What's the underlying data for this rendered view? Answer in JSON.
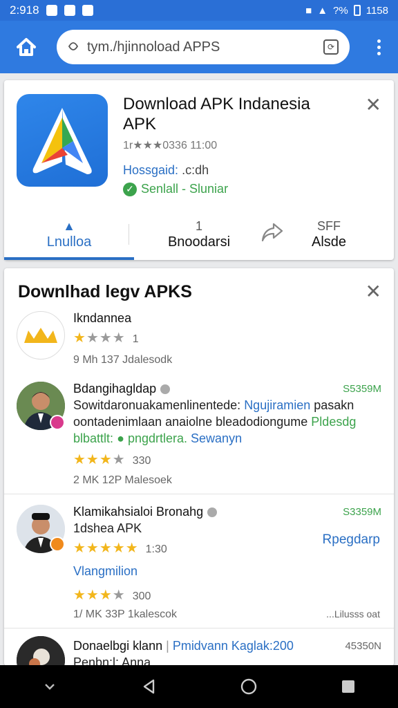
{
  "status": {
    "time": "2:918",
    "battery": "?%",
    "clock": "1158"
  },
  "browser": {
    "url": "tym./hjinnoload APPS",
    "tabs_count": "⟳"
  },
  "app_card": {
    "title": "Download APK Indanesia APK",
    "rating_text": "1r★★★0336 11:00",
    "meta_label": "Hossgaid:",
    "meta_value": ".c:dh",
    "status": "Senlall - Sluniar",
    "tabs": [
      {
        "icon": "▲",
        "label": "Lnulloa"
      },
      {
        "icon": "1",
        "label": "Bnoodarsi"
      },
      {
        "icon": "SFF",
        "label": "Alsde"
      }
    ]
  },
  "list_card": {
    "title": "Downlhad legv APKS",
    "items": [
      {
        "name": "Ikndannea",
        "stars_full": "★",
        "stars_mid": "★★★",
        "rating_count": "1",
        "meta": "9 Mh  137  Jdalesodk"
      },
      {
        "name": "Bdangihagldap",
        "size": "S5359M",
        "line1_a": "Sowitdaronuakamenlinentede:",
        "line1_b": "Ngujiramien",
        "line1_c": "pasakn",
        "line2_a": "oontadenimlaan anaiolne bleadodiongume",
        "line2_b": "Pldesdg",
        "line3_a": "blbattlt:",
        "line3_b": "pngdrtlera.",
        "line3_c": "Sewanyn",
        "stars": "★★★",
        "stars_empty": "★",
        "rating_count": "330",
        "meta": "2 MK  12P  Malesoek"
      },
      {
        "name": "Klamikahsialoi Bronahg",
        "size": "S3359M",
        "subtitle": "1dshea APK",
        "action": "Rpegdarp",
        "stars": "★★★★★",
        "rating_count": "1:30",
        "extra": "Vlangmilion",
        "stars2": "★★★",
        "stars2_empty": "★",
        "rating_count2": "300",
        "meta": "1/ MK  33P  1kalescok",
        "link": "...Lilusss oat"
      },
      {
        "name": "Donaelbgi klann",
        "name_b": "Pmidvann Kaglak:200",
        "size": "45350N",
        "subtitle": "Penbn:l: Anna"
      }
    ]
  },
  "colors": {
    "accent": "#2f7ae0",
    "link": "#2a6fc4",
    "success": "#3ca34c",
    "star": "#f2b61c"
  }
}
